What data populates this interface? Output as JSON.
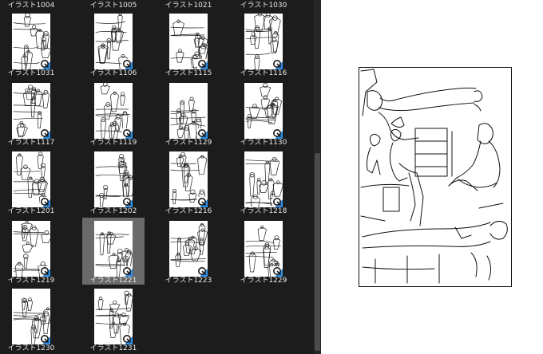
{
  "browser": {
    "top_labels": [
      "イラスト1004",
      "イラスト1005",
      "イラスト1021",
      "イラスト1030"
    ],
    "items": [
      {
        "label": "イラスト1031",
        "selected": false
      },
      {
        "label": "イラスト1106",
        "selected": false
      },
      {
        "label": "イラスト1115",
        "selected": false
      },
      {
        "label": "イラスト1116",
        "selected": false
      },
      {
        "label": "イラスト1117",
        "selected": false
      },
      {
        "label": "イラスト1119",
        "selected": false
      },
      {
        "label": "イラスト1129",
        "selected": false
      },
      {
        "label": "イラスト1130",
        "selected": false
      },
      {
        "label": "イラスト1201",
        "selected": false
      },
      {
        "label": "イラスト1202",
        "selected": false
      },
      {
        "label": "イラスト1216",
        "selected": false
      },
      {
        "label": "イラスト1218",
        "selected": false
      },
      {
        "label": "イラスト1219",
        "selected": false
      },
      {
        "label": "イラスト1221",
        "selected": true
      },
      {
        "label": "イラスト1223",
        "selected": false
      },
      {
        "label": "イラスト1229",
        "selected": false
      },
      {
        "label": "イラスト1230",
        "selected": false
      },
      {
        "label": "イラスト1231",
        "selected": false
      }
    ],
    "badge_icon": "clip-studio-asset-icon",
    "colors": {
      "background": "#1c1c1c",
      "selection": "#6a6a6a",
      "label_text": "#e6e6e6",
      "badge_blue": "#2f8ee6"
    }
  },
  "preview": {
    "selected_item": "イラスト1221"
  }
}
